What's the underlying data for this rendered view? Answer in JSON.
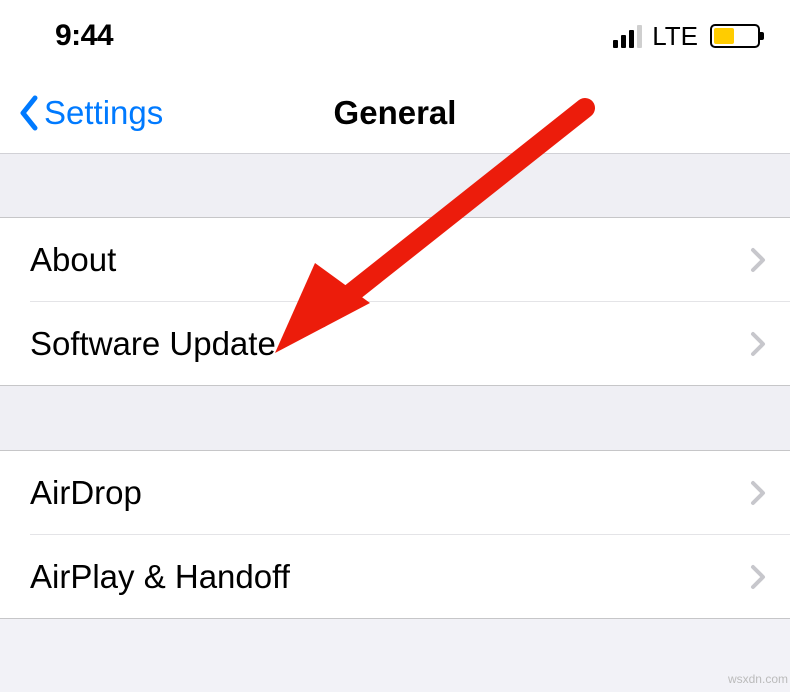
{
  "status": {
    "time": "9:44",
    "network": "LTE"
  },
  "nav": {
    "back_label": "Settings",
    "title": "General"
  },
  "groups": [
    {
      "rows": [
        "About",
        "Software Update"
      ]
    },
    {
      "rows": [
        "AirDrop",
        "AirPlay & Handoff"
      ]
    }
  ],
  "watermark": "wsxdn.com",
  "colors": {
    "tint": "#007aff",
    "arrow": "#ec1c0b",
    "battery_fill": "#ffcc00"
  }
}
